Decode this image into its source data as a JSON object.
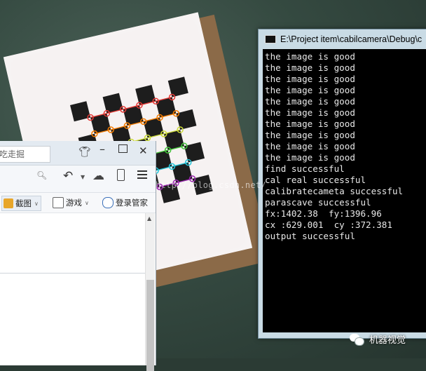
{
  "console": {
    "title": "E:\\Project item\\cabilcamera\\Debug\\c",
    "lines": [
      "the image is good",
      "the image is good",
      "the image is good",
      "the image is good",
      "the image is good",
      "the image is good",
      "the image is good",
      "the image is good",
      "the image is good",
      "the image is good",
      "find successful",
      "cal real successful",
      "calibratecameta successful",
      "parascave successful",
      "fx:1402.38  fy:1396.96",
      "cx :629.001  cy :372.381",
      "output successful"
    ]
  },
  "browser": {
    "new_tab_label": "+",
    "search_text": "吃走掘",
    "bookmarks": {
      "screenshot": "截图",
      "game": "游戏",
      "login_manager": "登录管家"
    }
  },
  "overlay": {
    "watermark": "http://blog.csdn.net/",
    "wechat_label": "机器视觉"
  },
  "colors": {
    "console_bg": "#000000",
    "console_text": "#e8e8e8",
    "window_frame": "#c9dbe5",
    "marker_red": "#e53935",
    "marker_orange": "#f57c00",
    "marker_yellow": "#cddc39",
    "marker_green": "#43c43a",
    "marker_cyan": "#26c6da",
    "marker_violet": "#9c27b0"
  }
}
